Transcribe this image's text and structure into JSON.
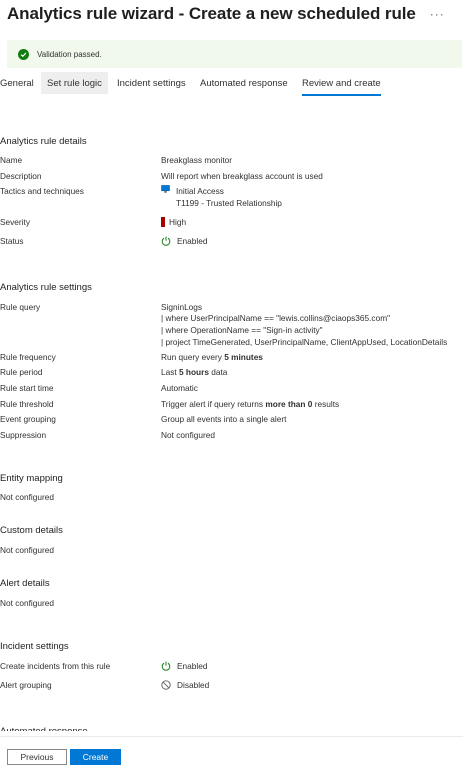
{
  "header": {
    "title": "Analytics rule wizard - Create a new scheduled rule",
    "more": "···"
  },
  "validation": {
    "text": "Validation passed."
  },
  "tabs": [
    "General",
    "Set rule logic",
    "Incident settings",
    "Automated response",
    "Review and create"
  ],
  "details": {
    "heading": "Analytics rule details",
    "name_label": "Name",
    "name_value": "Breakglass monitor",
    "description_label": "Description",
    "description_value": "Will report when breakglass account is used",
    "tactics_label": "Tactics and techniques",
    "tactic": "Initial Access",
    "technique": "T1199 - Trusted Relationship",
    "severity_label": "Severity",
    "severity_value": "High",
    "status_label": "Status",
    "status_value": "Enabled"
  },
  "settings": {
    "heading": "Analytics rule settings",
    "query_label": "Rule query",
    "query_lines": [
      "SigninLogs",
      "| where UserPrincipalName == \"lewis.collins@ciaops365.com\"",
      "| where OperationName == \"Sign-in activity\"",
      "| project TimeGenerated, UserPrincipalName, ClientAppUsed, LocationDetails"
    ],
    "frequency_label": "Rule frequency",
    "frequency_prefix": "Run query every ",
    "frequency_bold": "5 minutes",
    "period_label": "Rule period",
    "period_prefix": "Last ",
    "period_bold": "5 hours",
    "period_suffix": " data",
    "start_label": "Rule start time",
    "start_value": "Automatic",
    "threshold_label": "Rule threshold",
    "threshold_prefix": "Trigger alert if query returns ",
    "threshold_bold": "more than 0",
    "threshold_suffix": " results",
    "grouping_label": "Event grouping",
    "grouping_value": "Group all events into a single alert",
    "suppression_label": "Suppression",
    "suppression_value": "Not configured"
  },
  "entity_mapping": {
    "heading": "Entity mapping",
    "value": "Not configured"
  },
  "custom_details": {
    "heading": "Custom details",
    "value": "Not configured"
  },
  "alert_details": {
    "heading": "Alert details",
    "value": "Not configured"
  },
  "incident": {
    "heading": "Incident settings",
    "create_label": "Create incidents from this rule",
    "create_value": "Enabled",
    "grouping_label": "Alert grouping",
    "grouping_value": "Disabled"
  },
  "automated_heading": "Automated response",
  "footer": {
    "previous": "Previous",
    "create": "Create"
  },
  "colors": {
    "accent": "#0078d4",
    "severity_high": "#a80000",
    "success": "#107c10",
    "validation_bg": "#f1f9ec"
  }
}
